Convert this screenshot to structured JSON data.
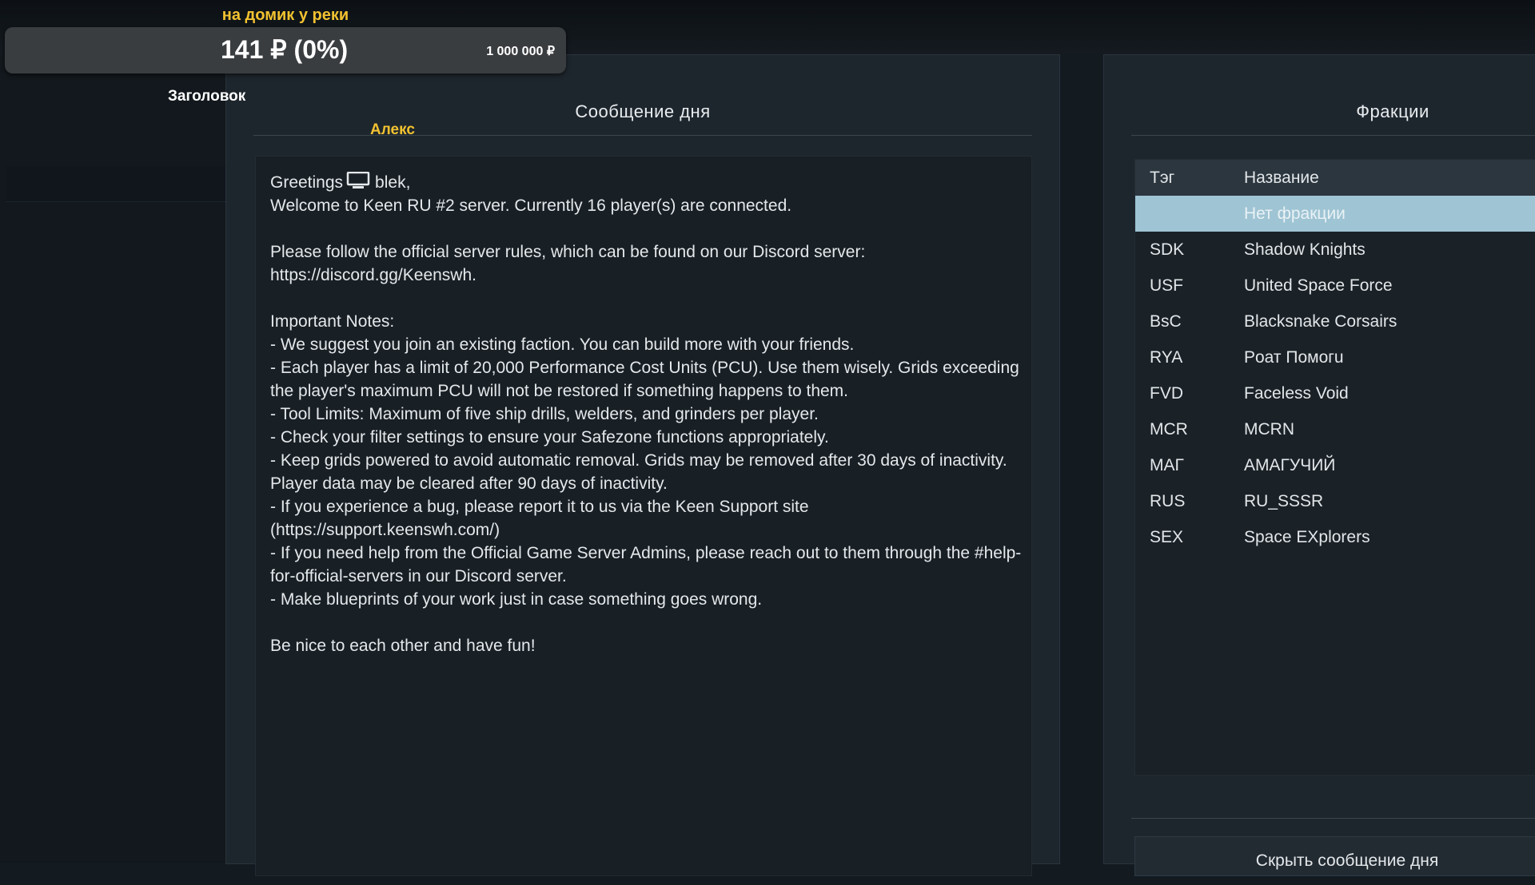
{
  "donation": {
    "title": "на домик у реки",
    "amount": "141 ₽ (0%)",
    "goal": "1 000 000 ₽",
    "progress_percent": 0
  },
  "overlay": {
    "heading": "Заголовок",
    "name_partial": "Алекс"
  },
  "motd": {
    "title": "Сообщение дня",
    "greeting_prefix": "Greetings",
    "greeting_name": "blek,",
    "body": "Welcome to Keen RU #2 server. Currently 16 player(s) are connected.\n\nPlease follow the official server rules, which can be found on our Discord server: https://discord.gg/Keenswh.\n\nImportant Notes:\n- We suggest you join an existing faction. You can build more with your friends.\n- Each player has a limit of 20,000 Performance Cost Units (PCU). Use them wisely. Grids exceeding the player's maximum PCU will not be restored if something happens to them.\n- Tool Limits: Maximum of five ship drills, welders, and grinders per player.\n- Check your filter settings to ensure your Safezone functions appropriately.\n- Keep grids powered to avoid automatic removal. Grids may be removed after 30 days of inactivity. Player data may be cleared after 90 days of inactivity.\n- If you experience a bug, please report it to us via the Keen Support site (https://support.keenswh.com/)\n- If you need help from the Official Game Server Admins, please reach out to them through the #help-for-official-servers in our Discord server.\n- Make blueprints of your work just in case something goes wrong.\n\nBe nice to each other and have fun!"
  },
  "factions": {
    "title": "Фракции",
    "col_tag": "Тэг",
    "col_name": "Название",
    "rows": [
      {
        "tag": "",
        "name": "Нет фракции"
      },
      {
        "tag": "SDK",
        "name": "Shadow Knights"
      },
      {
        "tag": "USF",
        "name": "United Space Force"
      },
      {
        "tag": "BsC",
        "name": "Blacksnake Corsairs"
      },
      {
        "tag": "RYA",
        "name": "Poат Пoмoгu"
      },
      {
        "tag": "FVD",
        "name": "Faceless Void"
      },
      {
        "tag": "MCR",
        "name": "MCRN"
      },
      {
        "tag": "MAГ",
        "name": "AMAГУЧИЙ"
      },
      {
        "tag": "RUS",
        "name": "RU_SSSR"
      },
      {
        "tag": "SEX",
        "name": "Space EXplorers"
      }
    ],
    "hide_button": "Скрыть сообщение дня"
  }
}
